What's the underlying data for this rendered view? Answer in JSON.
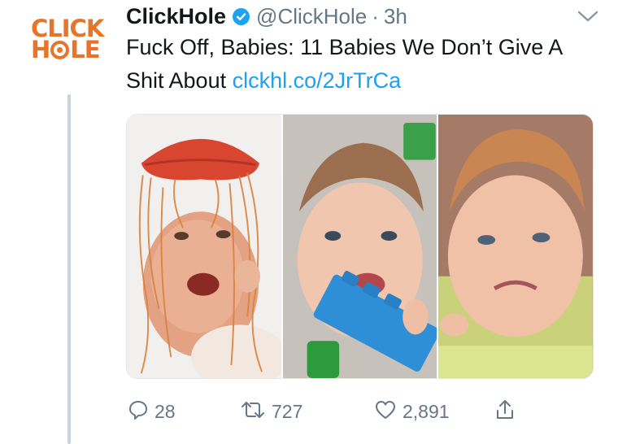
{
  "author": {
    "name": "ClickHole",
    "handle": "@ClickHole",
    "separator": "·",
    "time": "3h",
    "avatar_logo": {
      "line1": "CLICK",
      "line2_prefix": "H",
      "line2_suffix": "LE"
    },
    "verified_icon": "verified-badge-icon"
  },
  "tweet": {
    "text": "Fuck Off, Babies: 11 Babies We Don’t Give A Shit About ",
    "link": "clckhl.co/2JrTrCa"
  },
  "media": {
    "panels": [
      "baby-with-spaghetti",
      "baby-with-blue-toy-block",
      "crying-baby"
    ]
  },
  "actions": {
    "reply_count": "28",
    "retweet_count": "727",
    "like_count": "2,891"
  },
  "colors": {
    "brand_orange": "#e8742a",
    "link_blue": "#1da1f2",
    "muted_gray": "#657786"
  }
}
